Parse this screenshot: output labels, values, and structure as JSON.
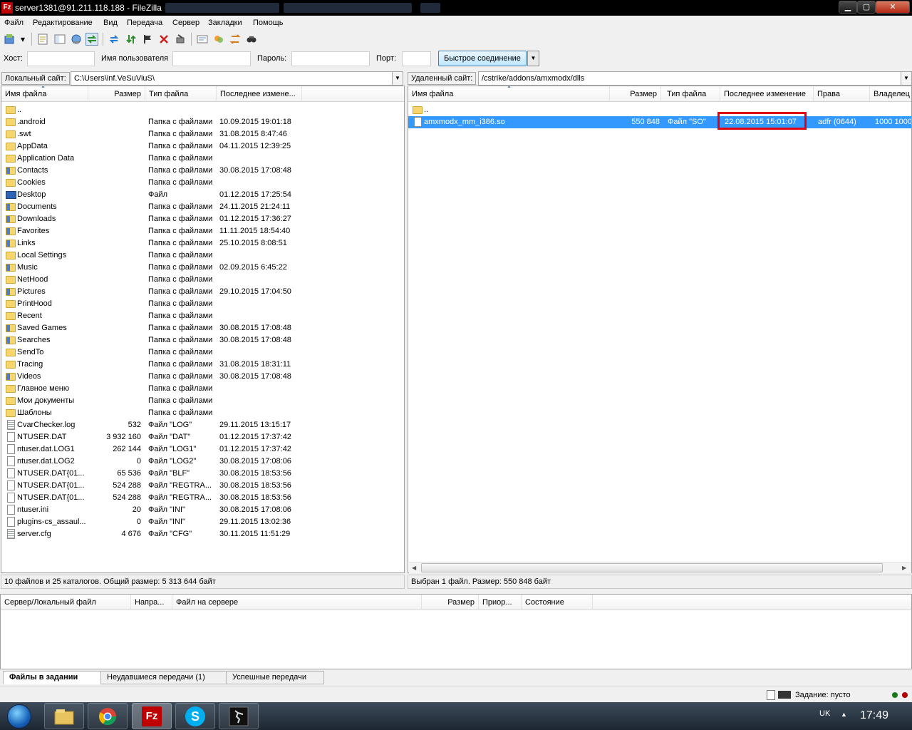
{
  "window": {
    "title": "server1381@91.211.118.188 - FileZilla"
  },
  "menu": [
    "Файл",
    "Редактирование",
    "Вид",
    "Передача",
    "Сервер",
    "Закладки",
    "Помощь"
  ],
  "quickconnect": {
    "host_label": "Хост:",
    "user_label": "Имя пользователя",
    "pass_label": "Пароль:",
    "port_label": "Порт:",
    "connect_label": "Быстрое соединение"
  },
  "local": {
    "site_label": "Локальный сайт:",
    "path": "C:\\Users\\inf.VeSuViuS\\",
    "columns": [
      "Имя файла",
      "Размер",
      "Тип файла",
      "Последнее измене..."
    ],
    "files": [
      {
        "name": "..",
        "size": "",
        "type": "",
        "date": "",
        "icon": "folder"
      },
      {
        "name": ".android",
        "size": "",
        "type": "Папка с файлами",
        "date": "10.09.2015 19:01:18",
        "icon": "folder"
      },
      {
        "name": ".swt",
        "size": "",
        "type": "Папка с файлами",
        "date": "31.08.2015 8:47:46",
        "icon": "folder"
      },
      {
        "name": "AppData",
        "size": "",
        "type": "Папка с файлами",
        "date": "04.11.2015 12:39:25",
        "icon": "folder"
      },
      {
        "name": "Application Data",
        "size": "",
        "type": "Папка с файлами",
        "date": "",
        "icon": "folder"
      },
      {
        "name": "Contacts",
        "size": "",
        "type": "Папка с файлами",
        "date": "30.08.2015 17:08:48",
        "icon": "folder-special"
      },
      {
        "name": "Cookies",
        "size": "",
        "type": "Папка с файлами",
        "date": "",
        "icon": "folder"
      },
      {
        "name": "Desktop",
        "size": "",
        "type": "Файл",
        "date": "01.12.2015 17:25:54",
        "icon": "monitor"
      },
      {
        "name": "Documents",
        "size": "",
        "type": "Папка с файлами",
        "date": "24.11.2015 21:24:11",
        "icon": "folder-special"
      },
      {
        "name": "Downloads",
        "size": "",
        "type": "Папка с файлами",
        "date": "01.12.2015 17:36:27",
        "icon": "folder-special"
      },
      {
        "name": "Favorites",
        "size": "",
        "type": "Папка с файлами",
        "date": "11.11.2015 18:54:40",
        "icon": "folder-special"
      },
      {
        "name": "Links",
        "size": "",
        "type": "Папка с файлами",
        "date": "25.10.2015 8:08:51",
        "icon": "folder-special"
      },
      {
        "name": "Local Settings",
        "size": "",
        "type": "Папка с файлами",
        "date": "",
        "icon": "folder"
      },
      {
        "name": "Music",
        "size": "",
        "type": "Папка с файлами",
        "date": "02.09.2015 6:45:22",
        "icon": "folder-special"
      },
      {
        "name": "NetHood",
        "size": "",
        "type": "Папка с файлами",
        "date": "",
        "icon": "folder"
      },
      {
        "name": "Pictures",
        "size": "",
        "type": "Папка с файлами",
        "date": "29.10.2015 17:04:50",
        "icon": "folder-special"
      },
      {
        "name": "PrintHood",
        "size": "",
        "type": "Папка с файлами",
        "date": "",
        "icon": "folder"
      },
      {
        "name": "Recent",
        "size": "",
        "type": "Папка с файлами",
        "date": "",
        "icon": "folder"
      },
      {
        "name": "Saved Games",
        "size": "",
        "type": "Папка с файлами",
        "date": "30.08.2015 17:08:48",
        "icon": "folder-special"
      },
      {
        "name": "Searches",
        "size": "",
        "type": "Папка с файлами",
        "date": "30.08.2015 17:08:48",
        "icon": "folder-special"
      },
      {
        "name": "SendTo",
        "size": "",
        "type": "Папка с файлами",
        "date": "",
        "icon": "folder"
      },
      {
        "name": "Tracing",
        "size": "",
        "type": "Папка с файлами",
        "date": "31.08.2015 18:31:11",
        "icon": "folder"
      },
      {
        "name": "Videos",
        "size": "",
        "type": "Папка с файлами",
        "date": "30.08.2015 17:08:48",
        "icon": "folder-special"
      },
      {
        "name": "Главное меню",
        "size": "",
        "type": "Папка с файлами",
        "date": "",
        "icon": "folder"
      },
      {
        "name": "Мои документы",
        "size": "",
        "type": "Папка с файлами",
        "date": "",
        "icon": "folder"
      },
      {
        "name": "Шаблоны",
        "size": "",
        "type": "Папка с файлами",
        "date": "",
        "icon": "folder"
      },
      {
        "name": "CvarChecker.log",
        "size": "532",
        "type": "Файл \"LOG\"",
        "date": "29.11.2015 13:15:17",
        "icon": "doc-txt"
      },
      {
        "name": "NTUSER.DAT",
        "size": "3 932 160",
        "type": "Файл \"DAT\"",
        "date": "01.12.2015 17:37:42",
        "icon": "doc"
      },
      {
        "name": "ntuser.dat.LOG1",
        "size": "262 144",
        "type": "Файл \"LOG1\"",
        "date": "01.12.2015 17:37:42",
        "icon": "doc"
      },
      {
        "name": "ntuser.dat.LOG2",
        "size": "0",
        "type": "Файл \"LOG2\"",
        "date": "30.08.2015 17:08:06",
        "icon": "doc"
      },
      {
        "name": "NTUSER.DAT{01...",
        "size": "65 536",
        "type": "Файл \"BLF\"",
        "date": "30.08.2015 18:53:56",
        "icon": "doc"
      },
      {
        "name": "NTUSER.DAT{01...",
        "size": "524 288",
        "type": "Файл \"REGTRA...",
        "date": "30.08.2015 18:53:56",
        "icon": "doc"
      },
      {
        "name": "NTUSER.DAT{01...",
        "size": "524 288",
        "type": "Файл \"REGTRA...",
        "date": "30.08.2015 18:53:56",
        "icon": "doc"
      },
      {
        "name": "ntuser.ini",
        "size": "20",
        "type": "Файл \"INI\"",
        "date": "30.08.2015 17:08:06",
        "icon": "doc"
      },
      {
        "name": "plugins-cs_assaul...",
        "size": "0",
        "type": "Файл \"INI\"",
        "date": "29.11.2015 13:02:36",
        "icon": "doc"
      },
      {
        "name": "server.cfg",
        "size": "4 676",
        "type": "Файл \"CFG\"",
        "date": "30.11.2015 11:51:29",
        "icon": "doc-txt"
      }
    ],
    "status": "10 файлов и 25 каталогов. Общий размер: 5 313 644 байт"
  },
  "remote": {
    "site_label": "Удаленный сайт:",
    "path": "/cstrike/addons/amxmodx/dlls",
    "columns": [
      "Имя файла",
      "Размер",
      "Тип файла",
      "Последнее изменение",
      "Права",
      "Владелец"
    ],
    "files": [
      {
        "name": "..",
        "size": "",
        "type": "",
        "date": "",
        "perms": "",
        "owner": "",
        "icon": "folder",
        "selected": false
      },
      {
        "name": "amxmodx_mm_i386.so",
        "size": "550 848",
        "type": "Файл \"SO\"",
        "date": "22.08.2015 15:01:07",
        "perms": "adfr (0644)",
        "owner": "1000 1000",
        "icon": "doc",
        "selected": true
      }
    ],
    "status": "Выбран 1 файл. Размер: 550 848 байт"
  },
  "queue": {
    "columns": [
      "Сервер/Локальный файл",
      "Напра...",
      "Файл на сервере",
      "Размер",
      "Приор...",
      "Состояние"
    ]
  },
  "tabs": [
    "Файлы в задании",
    "Неудавшиеся передачи (1)",
    "Успешные передачи"
  ],
  "bottom_status": {
    "queue_text": "Задание: пусто"
  },
  "taskbar": {
    "apps": [
      "explorer-icon",
      "chrome-icon",
      "filezilla-icon",
      "skype-icon",
      "counter-strike-icon"
    ],
    "lang": "UK",
    "time": "17:49"
  },
  "colors": {
    "selection": "#3399ff",
    "highlight_box": "#e0000f",
    "titlebar": "#000000"
  }
}
